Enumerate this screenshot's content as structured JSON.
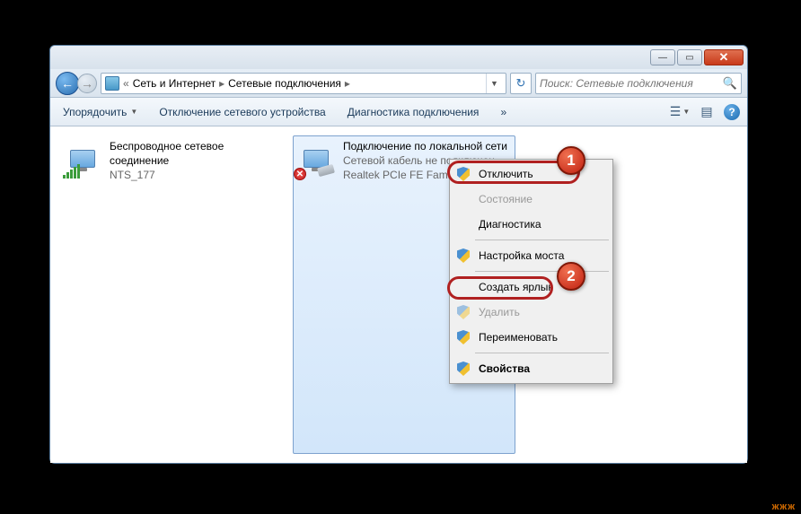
{
  "breadcrumb": {
    "prefix": "«",
    "seg1": "Сеть и Интернет",
    "seg2": "Сетевые подключения"
  },
  "search": {
    "placeholder": "Поиск: Сетевые подключения"
  },
  "toolbar": {
    "organize": "Упорядочить",
    "disable_device": "Отключение сетевого устройства",
    "diagnose": "Диагностика подключения",
    "more": "»"
  },
  "connections": [
    {
      "title": "Беспроводное сетевое соединение",
      "sub1": "",
      "sub2": "NTS_177"
    },
    {
      "title": "Подключение по локальной сети",
      "sub1": "Сетевой кабель не подключен",
      "sub2": "Realtek PCIe FE Family"
    }
  ],
  "context_menu": {
    "disable": "Отключить",
    "status": "Состояние",
    "diagnose": "Диагностика",
    "bridge": "Настройка моста",
    "shortcut": "Создать ярлык",
    "delete": "Удалить",
    "rename": "Переименовать",
    "properties": "Свойства"
  },
  "callouts": {
    "n1": "1",
    "n2": "2"
  },
  "watermark": "жжж"
}
